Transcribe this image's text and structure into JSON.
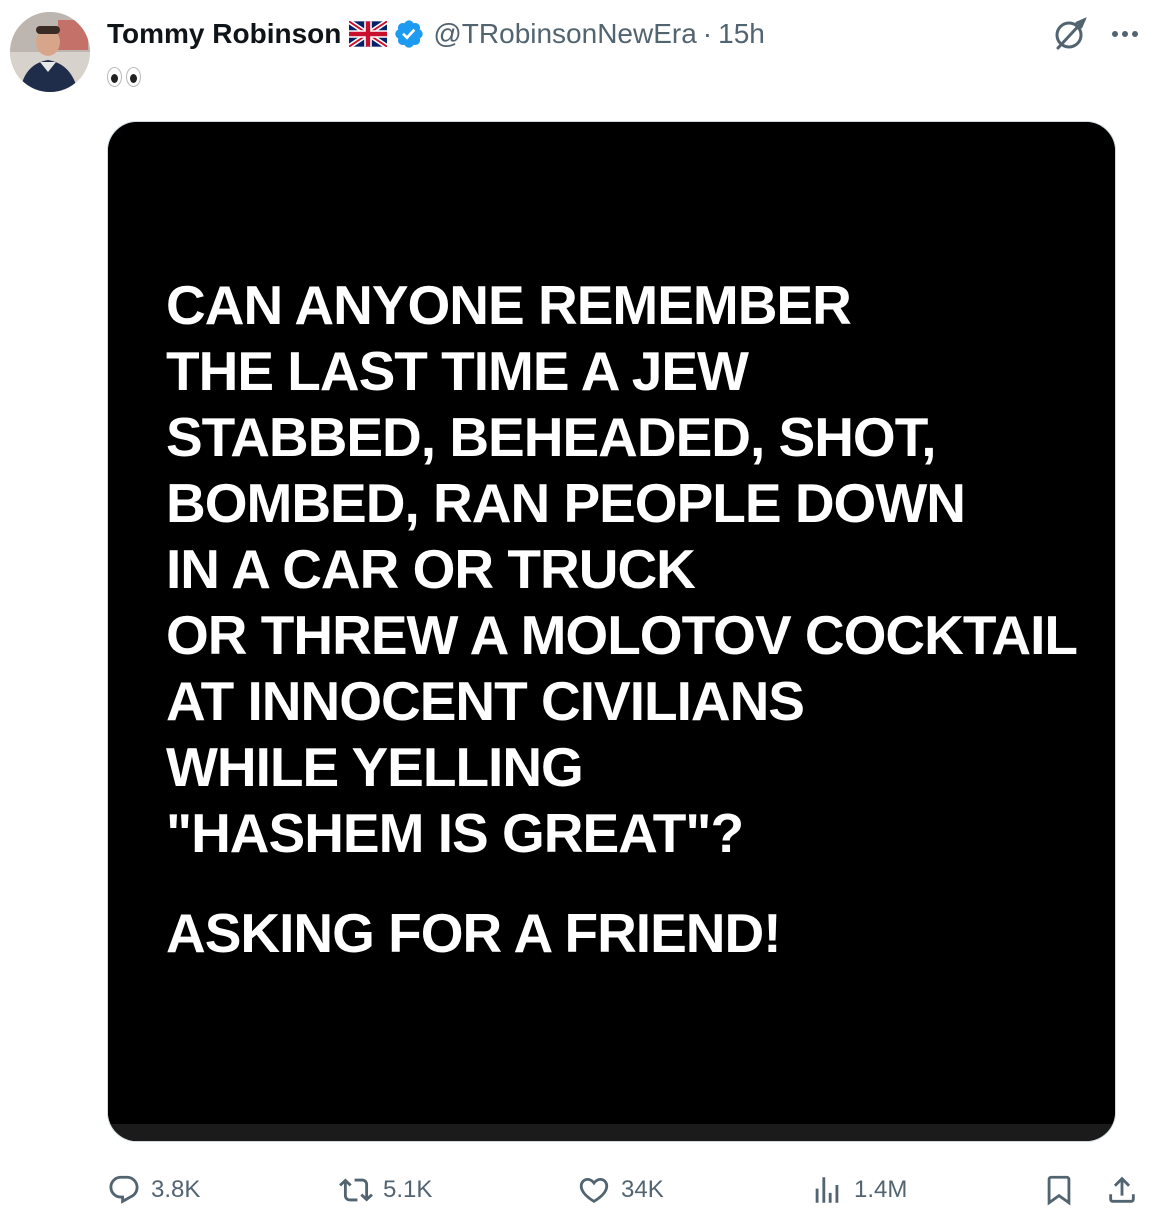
{
  "post": {
    "author": {
      "display_name": "Tommy Robinson",
      "flag": "uk-flag",
      "verified": true,
      "handle": "@TRobinsonNewEra",
      "separator": "·",
      "time": "15h"
    },
    "text_emoji": "eyes-emoji",
    "image": {
      "lines": [
        "CAN ANYONE REMEMBER",
        "THE LAST TIME A JEW",
        "STABBED, BEHEADED, SHOT,",
        "BOMBED, RAN PEOPLE DOWN",
        "IN A CAR OR TRUCK",
        "OR THREW A MOLOTOV COCKTAIL",
        "AT INNOCENT CIVILIANS",
        "WHILE YELLING",
        "\"HASHEM IS GREAT\"?"
      ],
      "closing_line": "ASKING FOR A FRIEND!",
      "background": "#000000",
      "text_color": "#ffffff"
    },
    "stats": {
      "replies": "3.8K",
      "reposts": "5.1K",
      "likes": "34K",
      "views": "1.4M"
    }
  },
  "colors": {
    "primary_text": "#0f1419",
    "secondary_text": "#536471",
    "verified_blue": "#1d9bf0"
  }
}
